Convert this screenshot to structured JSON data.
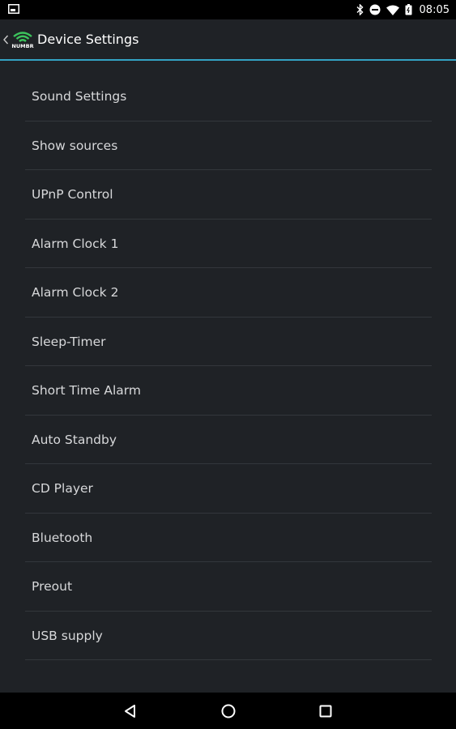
{
  "status_bar": {
    "time": "08:05",
    "icons": [
      "screenshot-icon",
      "bluetooth-icon",
      "do-not-disturb-icon",
      "wifi-icon",
      "battery-icon"
    ]
  },
  "app_bar": {
    "title": "Device Settings",
    "logo_text": "NUMBR"
  },
  "settings": {
    "items": [
      {
        "label": "Sound Settings"
      },
      {
        "label": "Show sources"
      },
      {
        "label": "UPnP Control"
      },
      {
        "label": "Alarm Clock 1"
      },
      {
        "label": "Alarm Clock 2"
      },
      {
        "label": "Sleep-Timer"
      },
      {
        "label": "Short Time Alarm"
      },
      {
        "label": "Auto Standby"
      },
      {
        "label": "CD Player"
      },
      {
        "label": "Bluetooth"
      },
      {
        "label": "Preout"
      },
      {
        "label": "USB supply"
      }
    ]
  },
  "nav_bar": {
    "icons": [
      "back-triangle-icon",
      "home-circle-icon",
      "recents-square-icon"
    ]
  },
  "colors": {
    "background": "#1f2226",
    "accent": "#33a3c4",
    "logo_green": "#3cc35c",
    "text": "#d7d8da"
  }
}
